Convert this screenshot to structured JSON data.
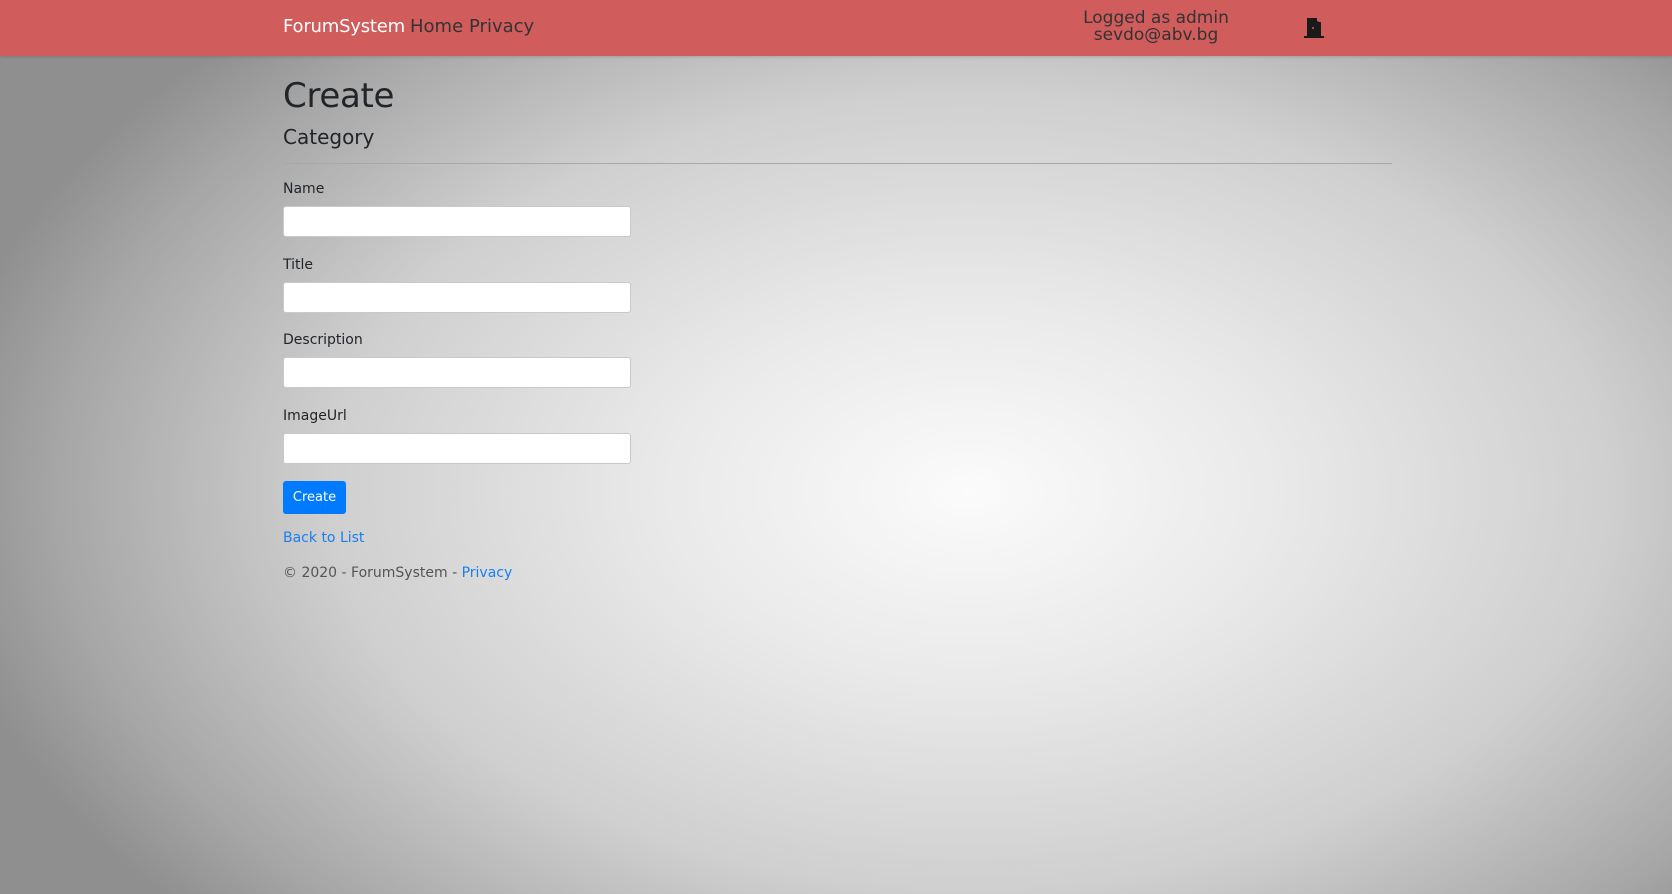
{
  "navbar": {
    "brand": "ForumSystem",
    "links": [
      {
        "label": "Home"
      },
      {
        "label": "Privacy"
      }
    ],
    "user_line1": "Logged as admin",
    "user_line2": "sevdo@abv.bg",
    "logout_icon": "door-exit-icon",
    "background_color": "#d05c5c"
  },
  "page": {
    "title": "Create",
    "subtitle": "Category"
  },
  "form": {
    "fields": [
      {
        "label": "Name",
        "value": "",
        "placeholder": ""
      },
      {
        "label": "Title",
        "value": "",
        "placeholder": ""
      },
      {
        "label": "Description",
        "value": "",
        "placeholder": ""
      },
      {
        "label": "ImageUrl",
        "value": "",
        "placeholder": ""
      }
    ],
    "submit_label": "Create",
    "submit_color": "#007bff"
  },
  "back_link": "Back to List",
  "footer": {
    "text": "© 2020 - ForumSystem - ",
    "link": "Privacy"
  }
}
